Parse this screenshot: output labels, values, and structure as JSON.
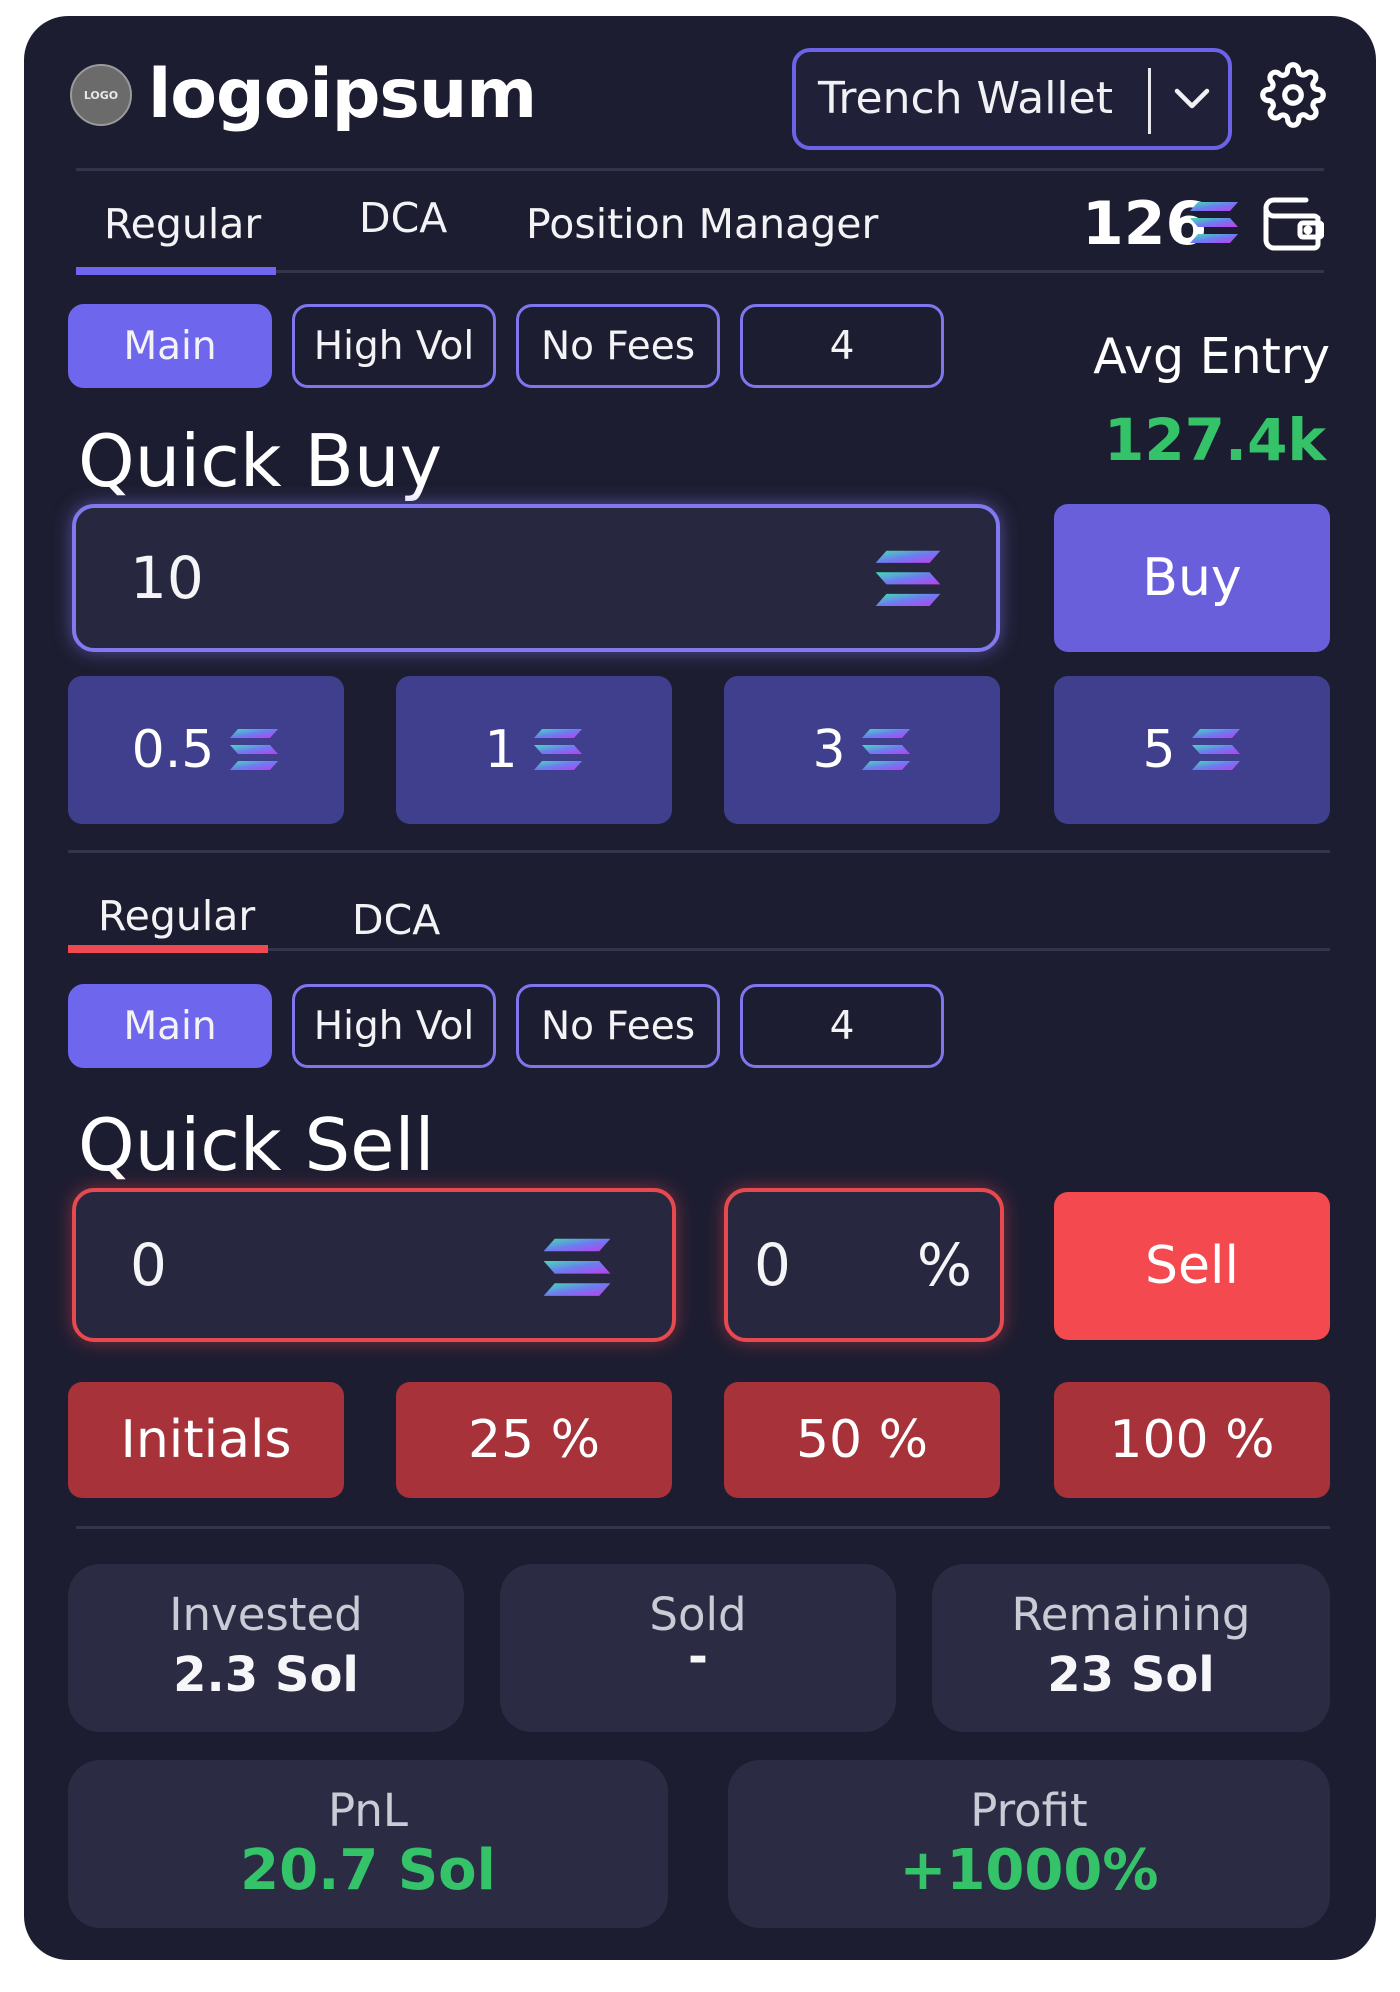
{
  "header": {
    "logo_badge": "LOGO",
    "logo_text": "logoipsum",
    "wallet_selector": "Trench Wallet"
  },
  "top_tabs": [
    {
      "label": "Regular",
      "active": true
    },
    {
      "label": "DCA",
      "active": false
    },
    {
      "label": "Position Manager",
      "active": false
    }
  ],
  "balance": "126",
  "buy": {
    "presets_tabs": [
      "Main",
      "High Vol",
      "No Fees",
      "4"
    ],
    "avg_entry_label": "Avg Entry",
    "avg_entry_value": "127.4k",
    "title": "Quick Buy",
    "amount": "10",
    "button": "Buy",
    "quick_amounts": [
      "0.5",
      "1",
      "3",
      "5"
    ]
  },
  "sell_tabs": [
    {
      "label": "Regular",
      "active": true
    },
    {
      "label": "DCA",
      "active": false
    }
  ],
  "sell": {
    "presets_tabs": [
      "Main",
      "High Vol",
      "No Fees",
      "4"
    ],
    "title": "Quick Sell",
    "amount": "0",
    "percent": "0",
    "percent_symbol": "%",
    "button": "Sell",
    "quick_options": [
      "Initials",
      "25 %",
      "50 %",
      "100 %"
    ]
  },
  "stats": {
    "invested_label": "Invested",
    "invested_value": "2.3 Sol",
    "sold_label": "Sold",
    "sold_value": "-",
    "remaining_label": "Remaining",
    "remaining_value": "23 Sol",
    "pnl_label": "PnL",
    "pnl_value": "20.7 Sol",
    "profit_label": "Profit",
    "profit_value": "+1000%"
  },
  "colors": {
    "panel": "#1d1d31",
    "accent": "#6f66ee",
    "sell": "#f4494f",
    "positive": "#35c36a"
  }
}
